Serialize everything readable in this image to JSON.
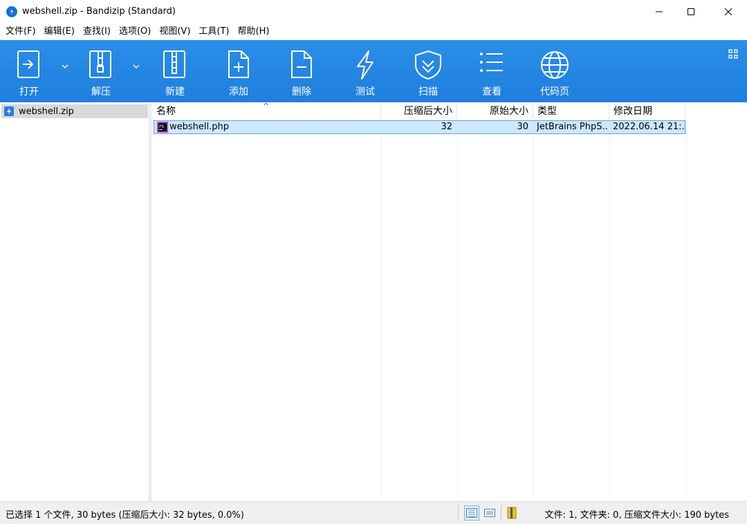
{
  "window": {
    "title": "webshell.zip - Bandizip (Standard)"
  },
  "menu": [
    {
      "label": "文件(F)"
    },
    {
      "label": "编辑(E)"
    },
    {
      "label": "查找(I)"
    },
    {
      "label": "选项(O)"
    },
    {
      "label": "视图(V)"
    },
    {
      "label": "工具(T)"
    },
    {
      "label": "帮助(H)"
    }
  ],
  "toolbar": {
    "open": "打开",
    "extract": "解压",
    "new": "新建",
    "add": "添加",
    "delete": "删除",
    "test": "测试",
    "scan": "扫描",
    "view": "查看",
    "codepage": "代码页"
  },
  "tree": {
    "root": "webshell.zip"
  },
  "columns": {
    "name": "名称",
    "packed": "压缩后大小",
    "original": "原始大小",
    "type": "类型",
    "modified": "修改日期"
  },
  "files": [
    {
      "name": "webshell.php",
      "packed": "32",
      "original": "30",
      "type": "JetBrains PhpS...",
      "modified": "2022.06.14 21:..."
    }
  ],
  "status": {
    "selection": "已选择 1 个文件, 30 bytes (压缩后大小: 32 bytes, 0.0%)",
    "summary": "文件: 1, 文件夹: 0, 压缩文件大小: 190 bytes"
  },
  "colors": {
    "toolbar": "#1f7fde",
    "selection": "#cce8ff"
  }
}
